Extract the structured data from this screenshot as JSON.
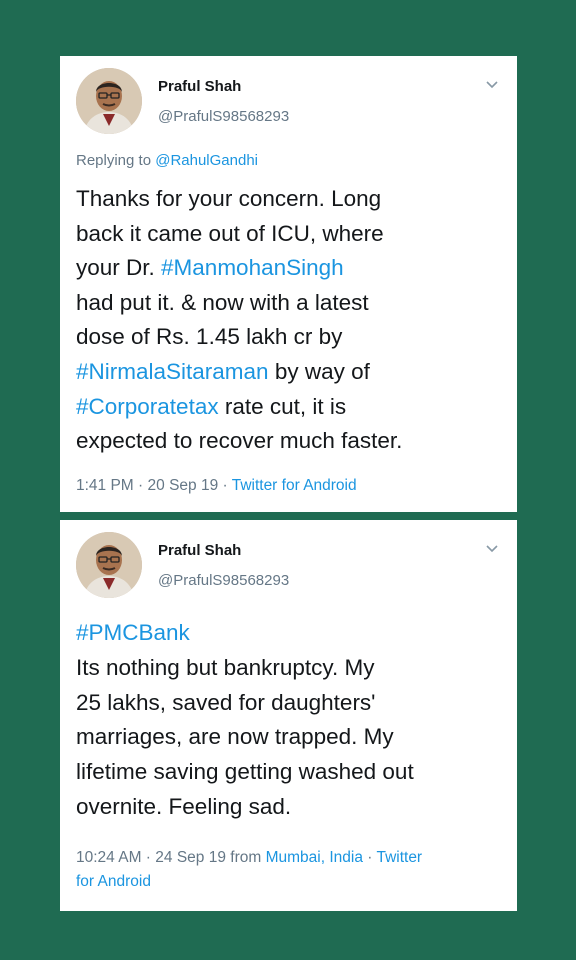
{
  "tweets": [
    {
      "author_name": "Praful Shah",
      "handle": "@PrafulS98568293",
      "replying_to_label": "Replying to",
      "replying_to_handle": "@RahulGandhi",
      "lines": [
        [
          {
            "t": "Thanks for your concern. Long",
            "tag": false
          }
        ],
        [
          {
            "t": "back it came out of ICU, where",
            "tag": false
          }
        ],
        [
          {
            "t": "your Dr. ",
            "tag": false
          },
          {
            "t": "#ManmohanSingh",
            "tag": true
          }
        ],
        [
          {
            "t": "had put it. & now with a latest",
            "tag": false
          }
        ],
        [
          {
            "t": "dose of Rs. 1.45 lakh cr by",
            "tag": false
          }
        ],
        [
          {
            "t": "#NirmalaSitaraman",
            "tag": true
          },
          {
            "t": " by way of",
            "tag": false
          }
        ],
        [
          {
            "t": "#Corporatetax",
            "tag": true
          },
          {
            "t": " rate cut, it is",
            "tag": false
          }
        ],
        [
          {
            "t": "expected to recover much faster.",
            "tag": false
          }
        ]
      ],
      "time": "1:41 PM",
      "date": "20 Sep 19",
      "source": "Twitter for Android"
    },
    {
      "author_name": "Praful Shah",
      "handle": "@PrafulS98568293",
      "lines": [
        [
          {
            "t": "#PMCBank",
            "tag": true
          }
        ],
        [
          {
            "t": "Its nothing but bankruptcy. My",
            "tag": false
          }
        ],
        [
          {
            "t": "25 lakhs, saved for daughters'",
            "tag": false
          }
        ],
        [
          {
            "t": "marriages, are now trapped. My",
            "tag": false
          }
        ],
        [
          {
            "t": "lifetime saving getting washed out",
            "tag": false
          }
        ],
        [
          {
            "t": "overnite. Feeling sad.",
            "tag": false
          }
        ]
      ],
      "time": "10:24 AM",
      "date": "24 Sep 19",
      "from_label": "from",
      "location": "Mumbai, India",
      "source_line1": "Twitter",
      "source_line2": "for Android"
    }
  ],
  "colors": {
    "background": "#1f6b52",
    "card": "#ffffff",
    "text": "#14171a",
    "muted": "#657786",
    "link": "#1b95e0"
  },
  "icons": [
    "avatar",
    "chevron-down-icon"
  ]
}
